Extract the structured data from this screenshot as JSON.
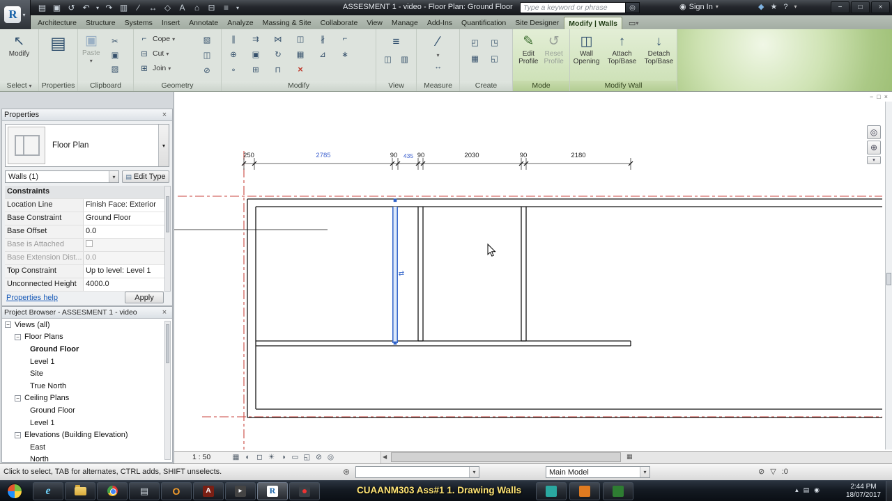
{
  "colors": {
    "selection_blue": "#2f62c9",
    "temp_dim_blue": "#3f62cf",
    "crop_red": "#c8433c",
    "contextual_green": "#cadfb2",
    "delete_red": "#c0392b",
    "caption_yellow": "#ffe473"
  },
  "title_bar": {
    "title": "ASSESMENT 1 - video - Floor Plan: Ground Floor",
    "search_placeholder": "Type a keyword or phrase",
    "sign_in_label": "Sign In"
  },
  "tabs": [
    "Architecture",
    "Structure",
    "Systems",
    "Insert",
    "Annotate",
    "Analyze",
    "Massing & Site",
    "Collaborate",
    "View",
    "Manage",
    "Add-Ins",
    "Quantification",
    "Site Designer",
    "Modify | Walls"
  ],
  "ribbon": {
    "select_label": "Select",
    "properties_label": "Properties",
    "clipboard_label": "Clipboard",
    "geometry_label": "Geometry",
    "modify_label": "Modify",
    "view_label": "View",
    "measure_label": "Measure",
    "create_label": "Create",
    "mode_label": "Mode",
    "modify_wall_label": "Modify Wall",
    "modify_button": "Modify",
    "paste_button": "Paste",
    "cope_button": "Cope",
    "cut_button": "Cut",
    "join_button": "Join",
    "edit_profile_line1": "Edit",
    "edit_profile_line2": "Profile",
    "reset_profile_line1": "Reset",
    "reset_profile_line2": "Profile",
    "wall_opening_line1": "Wall",
    "wall_opening_line2": "Opening",
    "attach_line1": "Attach",
    "attach_line2": "Top/Base",
    "detach_line1": "Detach",
    "detach_line2": "Top/Base"
  },
  "properties": {
    "header": "Properties",
    "type_selector": "Floor Plan",
    "filter": "Walls (1)",
    "edit_type": "Edit Type",
    "section": "Constraints",
    "rows": [
      {
        "label": "Location Line",
        "value": "Finish Face: Exterior"
      },
      {
        "label": "Base Constraint",
        "value": "Ground Floor"
      },
      {
        "label": "Base Offset",
        "value": "0.0"
      },
      {
        "label": "Base is Attached",
        "value": ""
      },
      {
        "label": "Base Extension Dist...",
        "value": "0.0"
      },
      {
        "label": "Top Constraint",
        "value": "Up to level: Level 1"
      },
      {
        "label": "Unconnected Height",
        "value": "4000.0"
      }
    ],
    "help_link": "Properties help",
    "apply_button": "Apply"
  },
  "project_browser": {
    "header": "Project Browser - ASSESMENT 1 - video",
    "tree": [
      {
        "label": "Views (all)"
      },
      {
        "label": "Floor Plans"
      },
      {
        "label": "Ground Floor"
      },
      {
        "label": "Level 1"
      },
      {
        "label": "Site"
      },
      {
        "label": "True North"
      },
      {
        "label": "Ceiling Plans"
      },
      {
        "label": "Ground Floor"
      },
      {
        "label": "Level 1"
      },
      {
        "label": "Elevations (Building Elevation)"
      },
      {
        "label": "East"
      },
      {
        "label": "North"
      }
    ]
  },
  "drawing": {
    "dims": [
      "250",
      "2785",
      "90",
      "435",
      "90",
      "2030",
      "90",
      "2180"
    ],
    "scale": "1 : 50"
  },
  "status_bar": {
    "message": "Click to select, TAB for alternates, CTRL adds, SHIFT unselects.",
    "design_option": "Main Model",
    "filter_count": ":0"
  },
  "taskbar": {
    "caption": "CUAANM303 Ass#1 1. Drawing Walls",
    "time": "2:44 PM",
    "date": "18/07/2017"
  },
  "icons": {
    "app_logo": "R",
    "dropdown": "▾",
    "open": "▤",
    "save": "▣",
    "sync": "↺",
    "undo": "↶",
    "redo": "↷",
    "print": "▥",
    "measure": "∕",
    "dimension": "↔",
    "tag": "◇",
    "text": "A",
    "home": "⌂",
    "section": "⊟",
    "thin_lines": "≡",
    "search": "◎",
    "exchange": "◆",
    "star": "★",
    "person": "◉",
    "help": "?",
    "minimize": "−",
    "restore": "□",
    "close": "×",
    "panel_toggle": "▭",
    "modify_cursor": "↖",
    "properties_big": "▤",
    "paste_big": "▣",
    "cut_clip": "✂",
    "copy_clip": "▣",
    "match": "▨",
    "cope": "⌐",
    "cut_geo": "⊟",
    "join_geo": "⊞",
    "paint": "▧",
    "split_face": "◫",
    "demolish": "⊘",
    "align": "∥",
    "offset": "⇉",
    "mirror_pick": "⋈",
    "mirror_draw": "◫",
    "split": "∦",
    "trim": "⌐",
    "move": "⊕",
    "copy": "▣",
    "rotate": "↻",
    "array": "▦",
    "scale2": "⊿",
    "pin": "∗",
    "unpin": "∘",
    "join2": "⊞",
    "wall_joins": "⊓",
    "delete": "×",
    "hidden_win": "◫",
    "tile": "▥",
    "create1": "◰",
    "create2": "◳",
    "create3": "▦",
    "create4": "◱",
    "edit_profile": "✎",
    "reset_profile": "↺",
    "wall_opening": "◫",
    "attach": "↑",
    "detach": "↓",
    "gear": "⊛",
    "exclude": "⊘",
    "filter": "▽",
    "flip": "⇄",
    "collapse": "−",
    "nav_wheel": "◎",
    "zoom": "⊕",
    "left_arrow": "◀",
    "grid": "▦",
    "detail": "◐",
    "style": "◻",
    "sun": "☀",
    "shadow": "◑",
    "crop": "▭",
    "crop_show": "◱",
    "reveal": "◎",
    "tray_up": "▴",
    "ie": "e",
    "outlook": "O",
    "adobe": "A",
    "media": "▸",
    "revit_r": "R",
    "generic_app": "▤"
  }
}
